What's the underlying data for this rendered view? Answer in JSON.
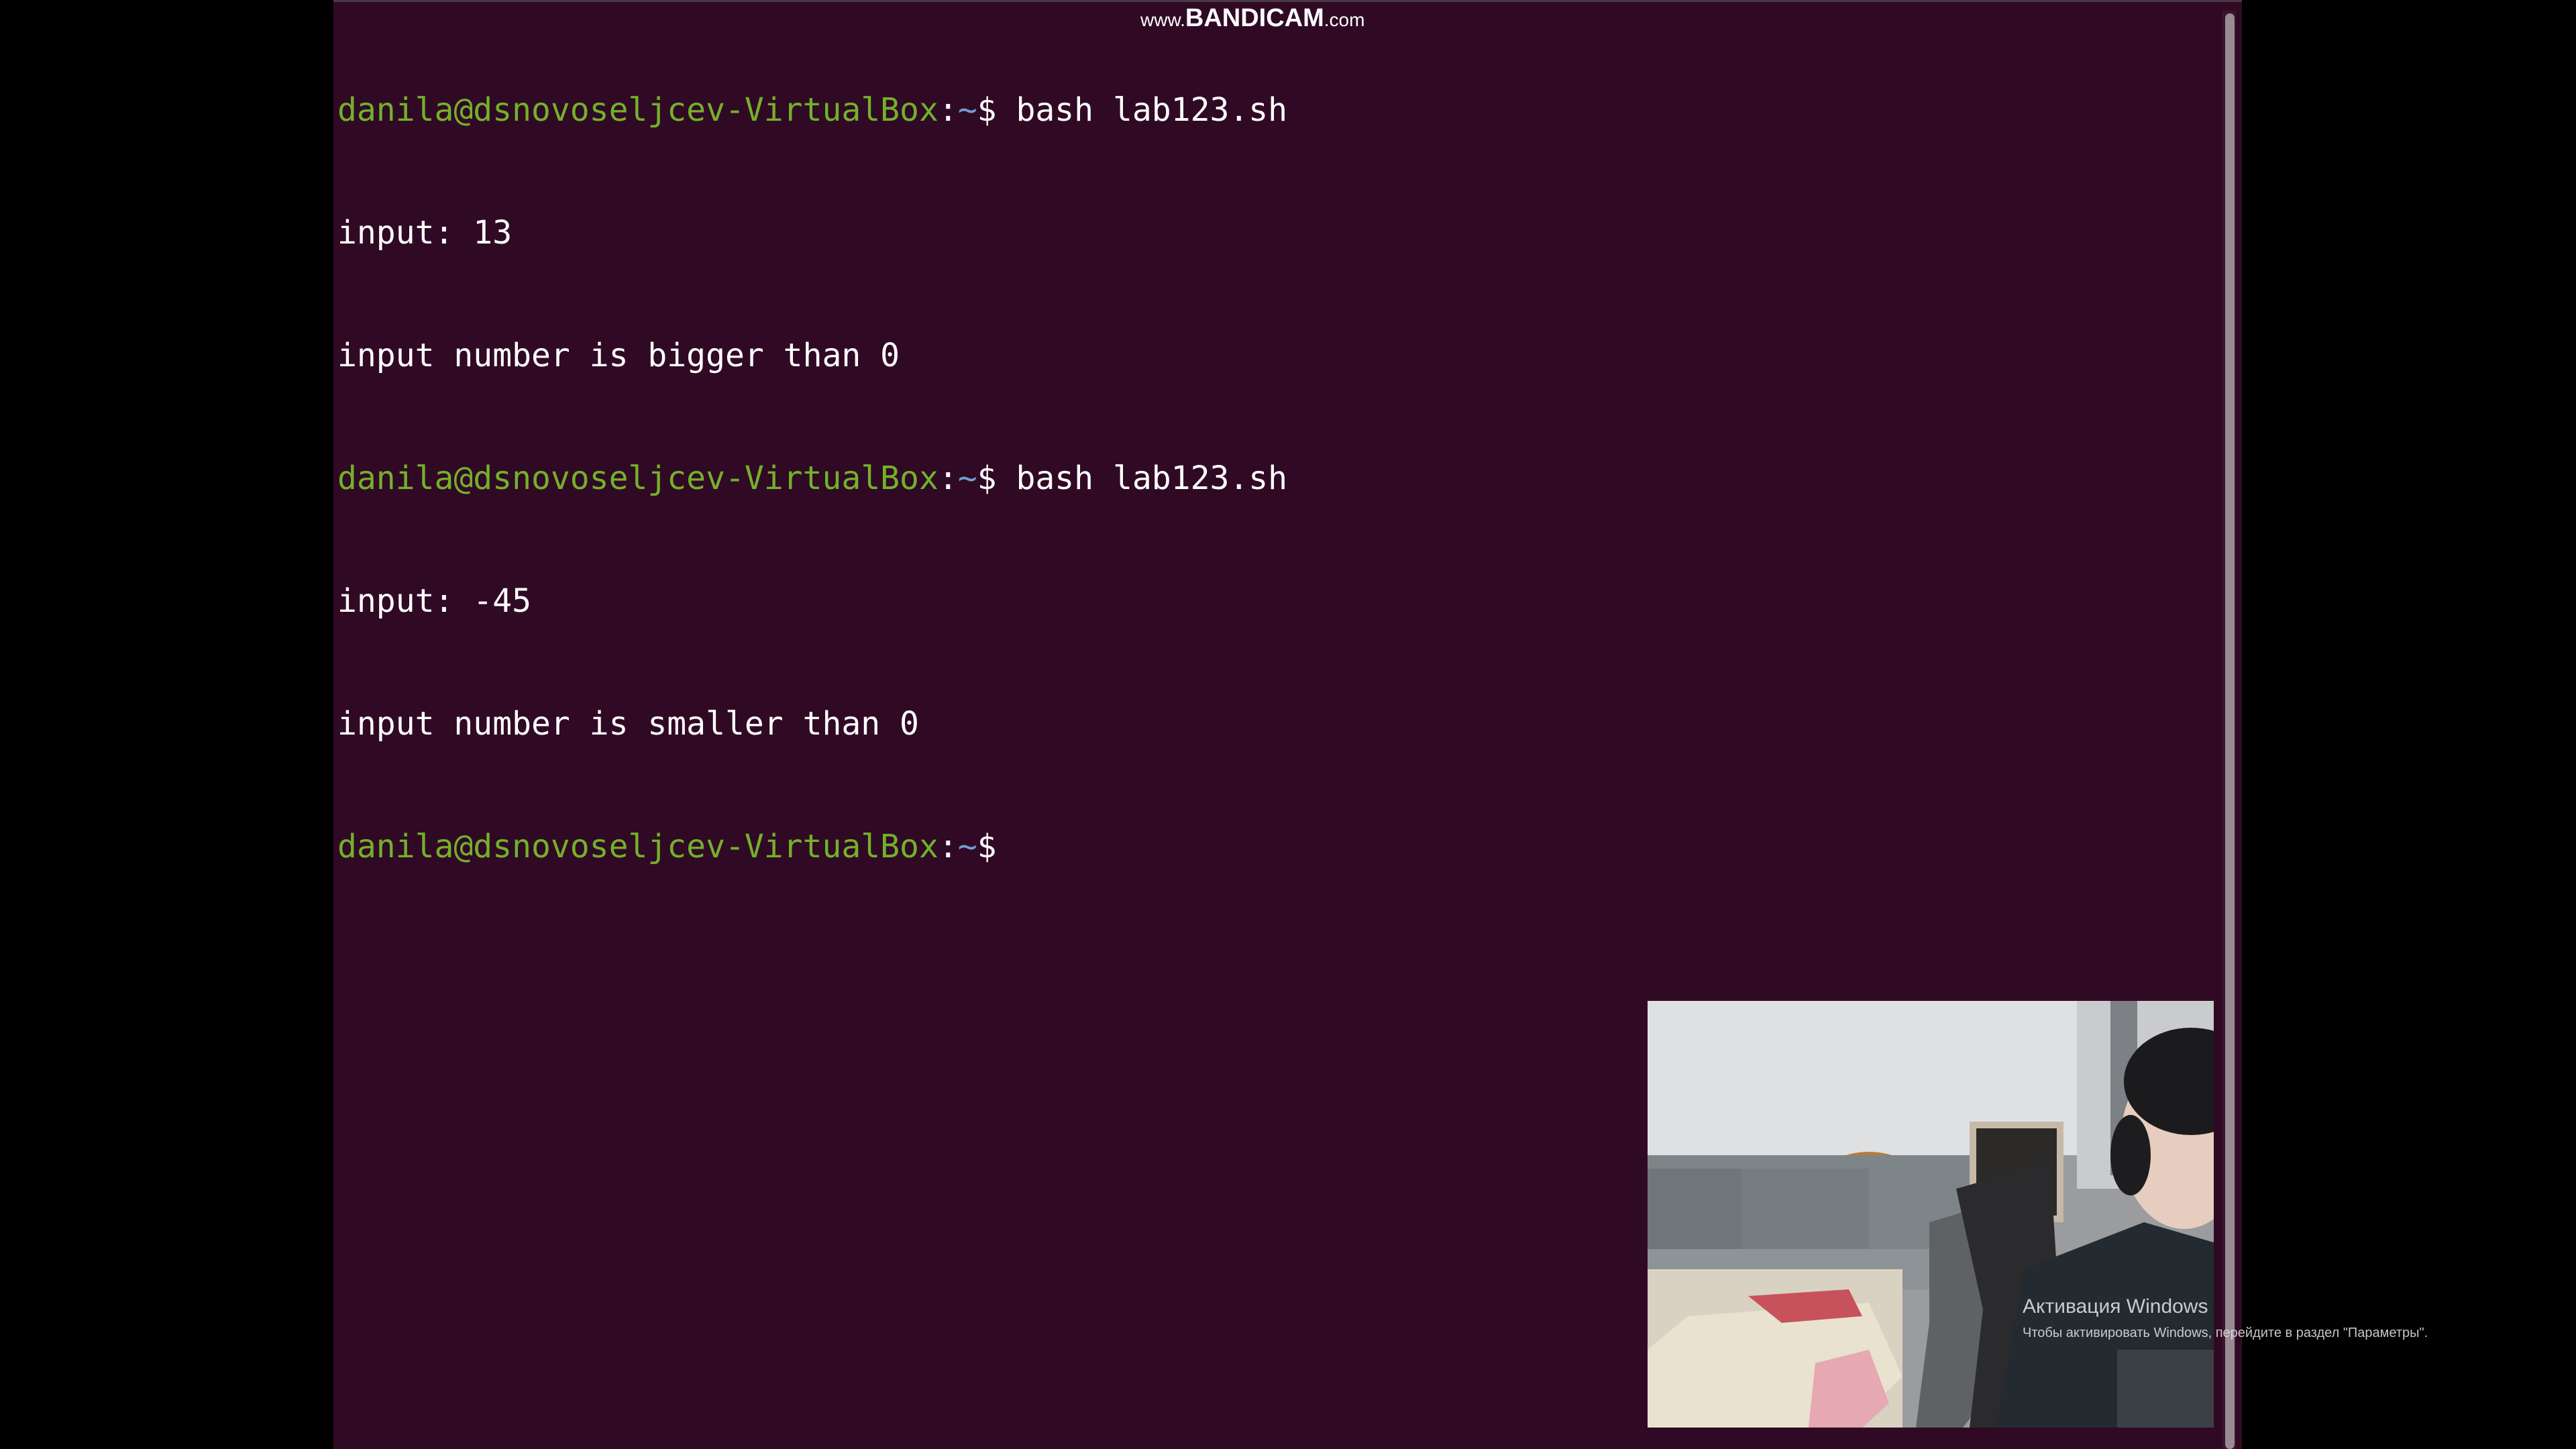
{
  "watermark": {
    "prefix": "www.",
    "brand": "BANDICAM",
    "suffix": ".com"
  },
  "terminal": {
    "prompt": {
      "user_host": "danila@dsnovoseljcev-VirtualBox",
      "colon": ":",
      "path": "~",
      "dollar": "$"
    },
    "lines": [
      {
        "type": "prompt",
        "command": " bash lab123.sh"
      },
      {
        "type": "output",
        "text": "input: 13"
      },
      {
        "type": "output",
        "text": "input number is bigger than 0"
      },
      {
        "type": "prompt",
        "command": " bash lab123.sh"
      },
      {
        "type": "output",
        "text": "input: -45"
      },
      {
        "type": "output",
        "text": "input number is smaller than 0"
      },
      {
        "type": "prompt",
        "command": ""
      }
    ]
  },
  "activation": {
    "title": "Активация Windows",
    "subtitle": "Чтобы активировать Windows, перейдите в раздел \"Параметры\"."
  },
  "colors": {
    "terminal_bg": "#300a24",
    "prompt_user": "#73b12b",
    "prompt_path": "#729fcf",
    "text": "#ffffff"
  }
}
